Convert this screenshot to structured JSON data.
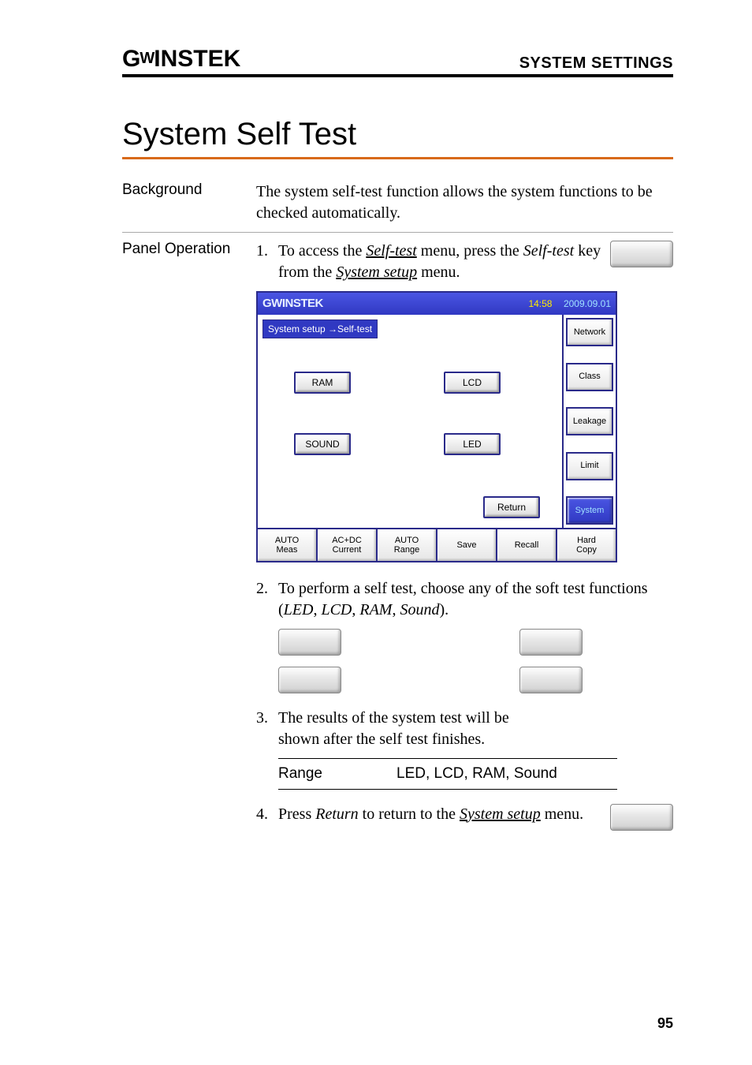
{
  "header": {
    "brand_g": "G",
    "brand_w": "W",
    "brand_rest": "INSTEK",
    "section": "SYSTEM SETTINGS"
  },
  "title": "System Self Test",
  "background": {
    "label": "Background",
    "text": "The system self-test function allows the system functions to be checked automatically."
  },
  "panel": {
    "label": "Panel Operation",
    "step1_num": "1.",
    "step1_a": "To access the ",
    "step1_b": "Self-test",
    "step1_c": " menu, press the ",
    "step1_d": "Self-test",
    "step1_e": " key from the ",
    "step1_f": "System setup",
    "step1_g": " menu.",
    "step2_num": "2.",
    "step2_a": "To perform a self test, choose any of the soft test functions (",
    "step2_b": "LED",
    "step2_c": ", ",
    "step2_d": "LCD",
    "step2_e": ", ",
    "step2_f": "RAM",
    "step2_g": ", ",
    "step2_h": "Sound",
    "step2_i": ").",
    "step3_num": "3.",
    "step3_text": "The results of the system test will be shown after the self test finishes.",
    "range_label": "Range",
    "range_value": "LED, LCD, RAM, Sound",
    "step4_num": "4.",
    "step4_a": "Press ",
    "step4_b": "Return",
    "step4_c": " to return to the ",
    "step4_d": "System setup",
    "step4_e": " menu."
  },
  "device": {
    "brand": "GWINSTEK",
    "time": "14:58",
    "date": "2009.09.01",
    "breadcrumb": "System setup →Self-test",
    "buttons": {
      "ram": "RAM",
      "lcd": "LCD",
      "sound": "SOUND",
      "led": "LED",
      "ret": "Return"
    },
    "side": [
      "Network",
      "Class",
      "Leakage",
      "Limit",
      "System"
    ],
    "bottom": [
      "AUTO\nMeas",
      "AC+DC\nCurrent",
      "AUTO\nRange",
      "Save",
      "Recall",
      "Hard\nCopy"
    ]
  },
  "page_number": "95"
}
